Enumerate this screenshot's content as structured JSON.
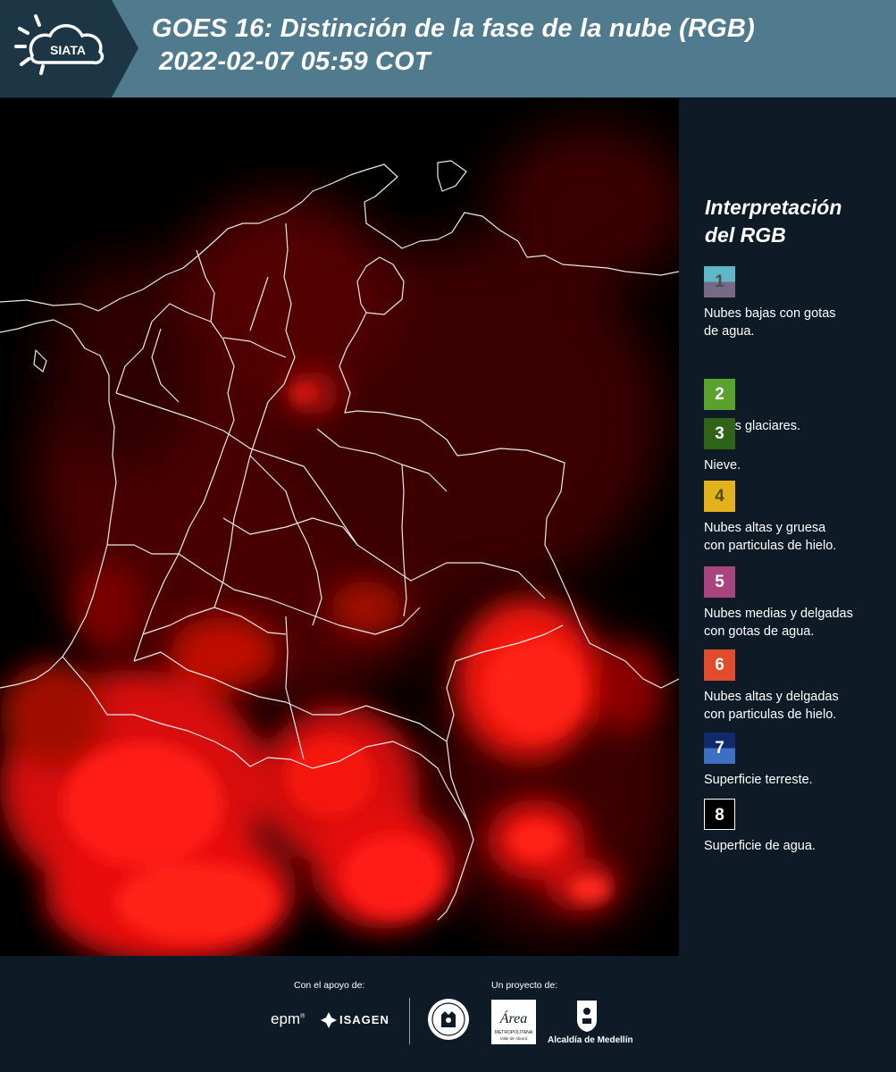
{
  "header": {
    "logo_text": "SIATA",
    "title_line1": "GOES 16: Distinción de la fase de la nube (RGB)",
    "title_line2": "2022-02-07 05:59 COT"
  },
  "legend": {
    "title_line1": "Interpretación",
    "title_line2": "del RGB",
    "items": [
      {
        "number": "1",
        "label_line1": "Nubes bajas con gotas",
        "label_line2": "de agua.",
        "color_top": "#5fb8c6",
        "color_bottom": "#786a86",
        "num_color": "#4a4a5a"
      },
      {
        "number": "2",
        "label_line1": "Nubes glaciares.",
        "label_line2": "",
        "color_top": "#5aa22e",
        "color_bottom": "#5aa22e",
        "num_color": "#ffffff"
      },
      {
        "number": "3",
        "label_line1": "Nieve.",
        "label_line2": "",
        "color_top": "#2f6418",
        "color_bottom": "#2f6418",
        "num_color": "#ffffff"
      },
      {
        "number": "4",
        "label_line1": "Nubes altas y gruesa",
        "label_line2": "con particulas de hielo.",
        "color_top": "#e3b11c",
        "color_bottom": "#e3b11c",
        "num_color": "#5a4a10"
      },
      {
        "number": "5",
        "label_line1": "Nubes medias y delgadas",
        "label_line2": "con gotas de agua.",
        "color_top": "#a8457e",
        "color_bottom": "#a8457e",
        "num_color": "#ffffff"
      },
      {
        "number": "6",
        "label_line1": "Nubes altas y delgadas",
        "label_line2": "con particulas de hielo.",
        "color_top": "#e04c2c",
        "color_bottom": "#e04c2c",
        "num_color": "#ffffff"
      },
      {
        "number": "7",
        "label_line1": "Superficie terreste.",
        "label_line2": "",
        "color_top": "#112a6c",
        "color_bottom": "#3f6fc4",
        "num_color": "#ffffff"
      },
      {
        "number": "8",
        "label_line1": "Superficie de agua.",
        "label_line2": "",
        "color_top": "#000000",
        "color_bottom": "#000000",
        "num_color": "#ffffff"
      }
    ]
  },
  "footer": {
    "support_caption": "Con el apoyo de:",
    "project_caption": "Un proyecto de:",
    "sponsor_epm": "epm",
    "sponsor_isagen": "ISAGEN",
    "partner_area": "Área",
    "partner_area_sub1": "METROPOLITANA",
    "partner_area_sub2": "Valle de Aburrá",
    "partner_alcaldia": "Alcaldía de Medellín"
  },
  "colors": {
    "header_bg": "#507a8d",
    "page_bg": "#0e1b26",
    "cloud_red": "#ff1a10"
  }
}
